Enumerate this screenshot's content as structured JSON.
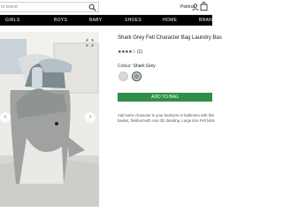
{
  "header": {
    "search_placeholder": "or brand",
    "account_name": "Petrina",
    "search_icon": "search-icon",
    "account_icon": "user-icon",
    "bag_icon": "shopping-bag-icon"
  },
  "nav": {
    "items": [
      {
        "label": "GIRLS"
      },
      {
        "label": "BOYS"
      },
      {
        "label": "BABY"
      },
      {
        "label": "SHOES"
      },
      {
        "label": "HOME"
      },
      {
        "label": "BRAN"
      }
    ]
  },
  "product": {
    "title": "Shark Grey Felt Character Bag Laundry Bas",
    "stars": "★★★★☆",
    "review_count": "(1)",
    "colour_label": "Colour:",
    "colour_value": "Shark Grey",
    "add_to_bag_label": "ADD TO BAG",
    "description_lines": [
      "Add some character to your bedroom or bathroom with this ado",
      "basket, finished with cute 3D detailing. Large size Felt fabric 3D"
    ]
  },
  "colors": {
    "nav_background": "#000000",
    "add_button": "#2f8f46",
    "shark_grey": "#9a9c98"
  }
}
